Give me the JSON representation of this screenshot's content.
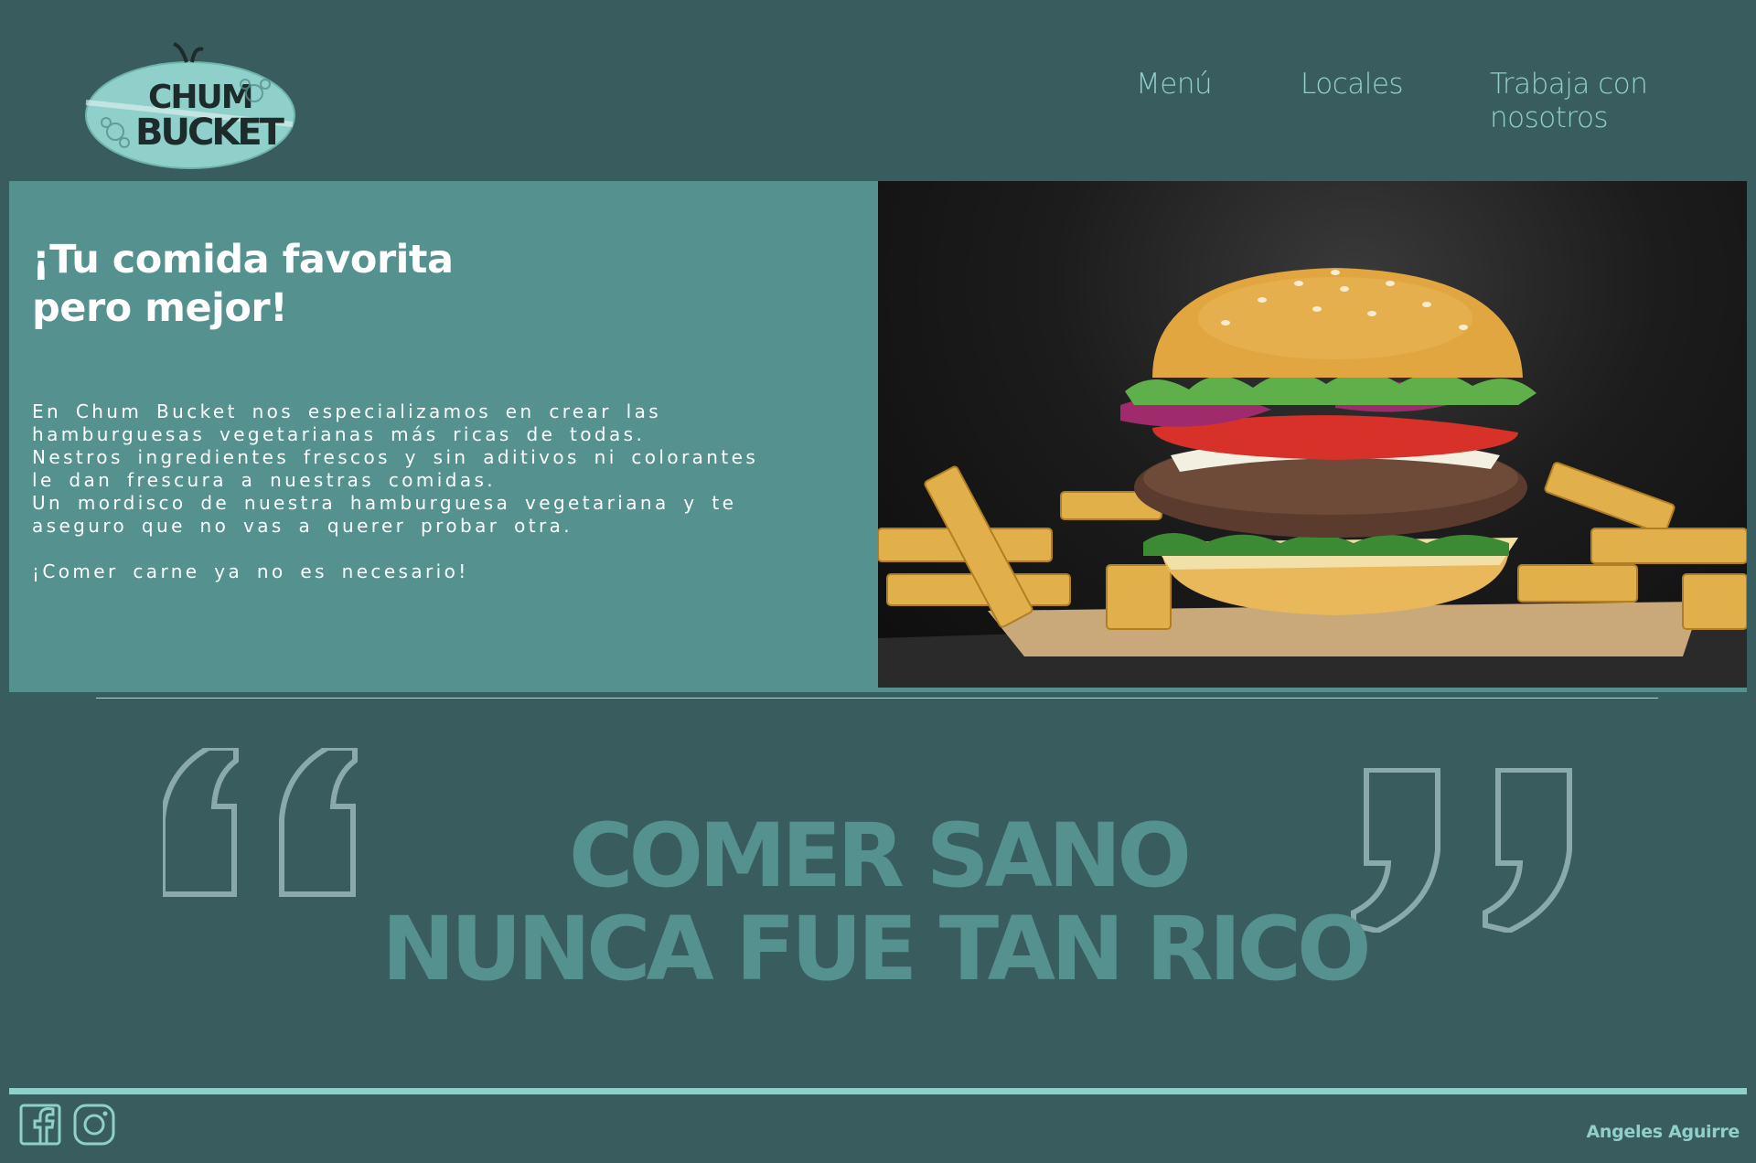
{
  "header": {
    "logo_text_top": "CHUM",
    "logo_text_bottom": "BUCKET",
    "nav": [
      {
        "label": "Menú"
      },
      {
        "label": "Locales"
      },
      {
        "label": "Trabaja con nosotros"
      }
    ]
  },
  "hero": {
    "title_line1": "¡Tu comida favorita",
    "title_line2": "pero mejor!",
    "paragraph1": "En Chum Bucket nos especializamos en crear las hamburguesas vegetarianas más ricas de todas.",
    "paragraph2": "Nestros ingredientes frescos y sin aditivos ni colorantes le dan frescura a nuestras comidas.",
    "paragraph3": "Un mordisco de nuestra hamburguesa vegetariana y te aseguro que no vas a querer probar otra.",
    "paragraph4": "¡Comer carne ya no es necesario!"
  },
  "quote": {
    "line1": "COMER SANO",
    "line2": "NUNCA FUE TAN RICO"
  },
  "footer": {
    "author": "Angeles Aguirre",
    "icons": [
      "facebook-icon",
      "instagram-icon"
    ]
  },
  "colors": {
    "background": "#395c5f",
    "panel": "#54918f",
    "accent": "#8fd0cb",
    "text": "#ffffff"
  }
}
